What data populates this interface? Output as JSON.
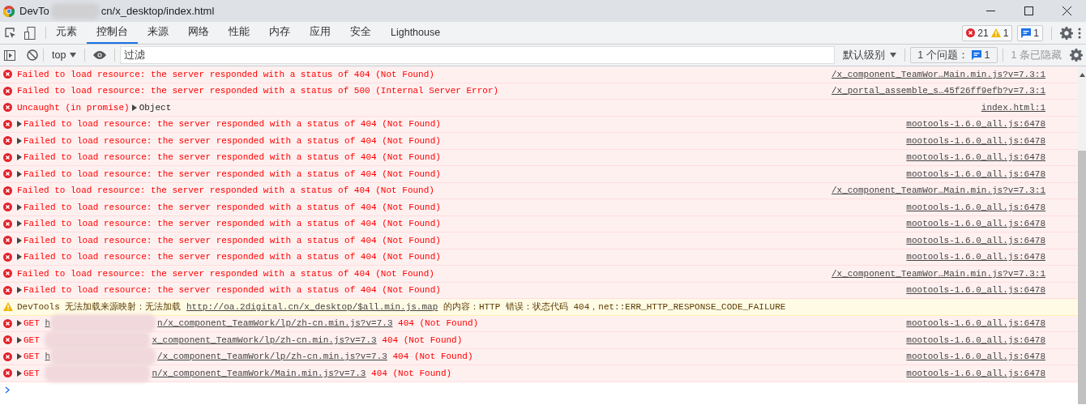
{
  "window": {
    "title_start": "DevTo",
    "title_end": "cn/x_desktop/index.html"
  },
  "tabs": [
    {
      "label": "元素",
      "selected": false
    },
    {
      "label": "控制台",
      "selected": true
    },
    {
      "label": "来源",
      "selected": false
    },
    {
      "label": "网络",
      "selected": false
    },
    {
      "label": "性能",
      "selected": false
    },
    {
      "label": "内存",
      "selected": false
    },
    {
      "label": "应用",
      "selected": false
    },
    {
      "label": "安全",
      "selected": false
    },
    {
      "label": "Lighthouse",
      "selected": false
    }
  ],
  "counters": {
    "errors": "21",
    "warnings": "1",
    "issues": "1"
  },
  "toolbar": {
    "context": "top",
    "filter": {
      "placeholder": "过滤"
    },
    "level": "默认级别",
    "issues_label": "1 个问题：",
    "issues_count": "1",
    "hidden": "1 条已隐藏"
  },
  "messages": [
    {
      "kind": "error",
      "expandable": false,
      "text": "Failed to load resource: the server responded with a status of 404 (Not Found)",
      "source": "/x_component_TeamWor…Main.min.js?v=7.3:1"
    },
    {
      "kind": "error",
      "expandable": false,
      "text": "Failed to load resource: the server responded with a status of 500 (Internal Server Error)",
      "source": "/x_portal_assemble_s…45f26ff9efb?v=7.3:1"
    },
    {
      "kind": "error",
      "expandable": false,
      "text": "Uncaught (in promise)",
      "object": "Object",
      "source": "index.html:1"
    },
    {
      "kind": "error",
      "expandable": true,
      "text": "Failed to load resource: the server responded with a status of 404 (Not Found)",
      "source": "mootools-1.6.0_all.js:6478"
    },
    {
      "kind": "error",
      "expandable": true,
      "text": "Failed to load resource: the server responded with a status of 404 (Not Found)",
      "source": "mootools-1.6.0_all.js:6478"
    },
    {
      "kind": "error",
      "expandable": true,
      "text": "Failed to load resource: the server responded with a status of 404 (Not Found)",
      "source": "mootools-1.6.0_all.js:6478"
    },
    {
      "kind": "error",
      "expandable": true,
      "text": "Failed to load resource: the server responded with a status of 404 (Not Found)",
      "source": "mootools-1.6.0_all.js:6478"
    },
    {
      "kind": "error",
      "expandable": false,
      "text": "Failed to load resource: the server responded with a status of 404 (Not Found)",
      "source": "/x_component_TeamWor…Main.min.js?v=7.3:1"
    },
    {
      "kind": "error",
      "expandable": true,
      "text": "Failed to load resource: the server responded with a status of 404 (Not Found)",
      "source": "mootools-1.6.0_all.js:6478"
    },
    {
      "kind": "error",
      "expandable": true,
      "text": "Failed to load resource: the server responded with a status of 404 (Not Found)",
      "source": "mootools-1.6.0_all.js:6478"
    },
    {
      "kind": "error",
      "expandable": true,
      "text": "Failed to load resource: the server responded with a status of 404 (Not Found)",
      "source": "mootools-1.6.0_all.js:6478"
    },
    {
      "kind": "error",
      "expandable": true,
      "text": "Failed to load resource: the server responded with a status of 404 (Not Found)",
      "source": "mootools-1.6.0_all.js:6478"
    },
    {
      "kind": "error",
      "expandable": false,
      "text": "Failed to load resource: the server responded with a status of 404 (Not Found)",
      "source": "/x_component_TeamWor…Main.min.js?v=7.3:1"
    },
    {
      "kind": "error",
      "expandable": true,
      "text": "Failed to load resource: the server responded with a status of 404 (Not Found)",
      "source": "mootools-1.6.0_all.js:6478"
    },
    {
      "kind": "warning",
      "expandable": false,
      "text": "DevTools 无法加载来源映射：无法加载",
      "link": "http://oa.2digital.cn/x_desktop/$all.min.js.map",
      "text_after": "的内容：HTTP 错误：状态代码 404，net::ERR_HTTP_RESPONSE_CODE_FAILURE"
    },
    {
      "kind": "error",
      "expandable": true,
      "method": "GET",
      "request_start": "h",
      "request": "n/x_component_TeamWork/lp/zh-cn.min.js?v=7.3",
      "status": "404 (Not Found)",
      "source": "mootools-1.6.0_all.js:6478"
    },
    {
      "kind": "error",
      "expandable": true,
      "method": "GET",
      "request": "x_component_TeamWork/lp/zh-cn.min.js?v=7.3",
      "status": "404 (Not Found)",
      "source": "mootools-1.6.0_all.js:6478"
    },
    {
      "kind": "error",
      "expandable": true,
      "method": "GET",
      "request_start": "h",
      "request": "/x_component_TeamWork/lp/zh-cn.min.js?v=7.3",
      "status": "404 (Not Found)",
      "source": "mootools-1.6.0_all.js:6478"
    },
    {
      "kind": "error",
      "expandable": true,
      "method": "GET",
      "request": "n/x_component_TeamWork/Main.min.js?v=7.3",
      "status": "404 (Not Found)",
      "source": "mootools-1.6.0_all.js:6478"
    }
  ]
}
